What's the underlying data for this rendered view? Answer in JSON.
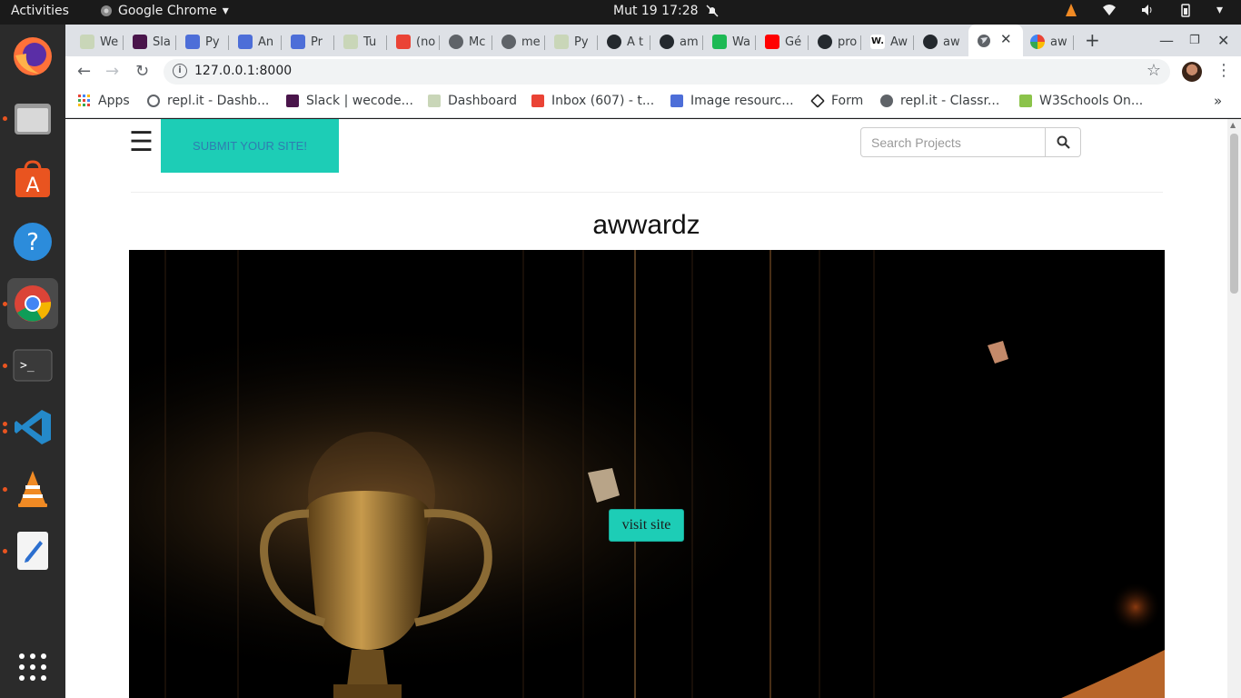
{
  "system": {
    "activities": "Activities",
    "app_name": "Google Chrome",
    "clock": "Mut 19  17:28"
  },
  "tabs": [
    {
      "label": "We"
    },
    {
      "label": "Sla"
    },
    {
      "label": "Py"
    },
    {
      "label": "An"
    },
    {
      "label": "Pr"
    },
    {
      "label": "Tu"
    },
    {
      "label": "(no"
    },
    {
      "label": "Mc"
    },
    {
      "label": "me"
    },
    {
      "label": "Py"
    },
    {
      "label": "A t"
    },
    {
      "label": "am"
    },
    {
      "label": "Wa"
    },
    {
      "label": "Gé"
    },
    {
      "label": "pro"
    },
    {
      "label": "Aw"
    },
    {
      "label": "aw"
    },
    {
      "label": ""
    },
    {
      "label": "aw"
    }
  ],
  "address": {
    "url": "127.0.0.1:8000"
  },
  "bookmarks": [
    {
      "label": "Apps"
    },
    {
      "label": "repl.it - Dashb..."
    },
    {
      "label": "Slack | wecode..."
    },
    {
      "label": "Dashboard"
    },
    {
      "label": "Inbox (607) - t..."
    },
    {
      "label": "Image resourc..."
    },
    {
      "label": "Form"
    },
    {
      "label": "repl.it - Classr..."
    },
    {
      "label": "W3Schools On..."
    }
  ],
  "site": {
    "submit_label": "SUBMIT YOUR SITE!",
    "search_placeholder": "Search Projects",
    "title": "awwardz",
    "visit_label": "visit site"
  },
  "colors": {
    "accent": "#1dcdb6",
    "link": "#2f7cb1"
  }
}
